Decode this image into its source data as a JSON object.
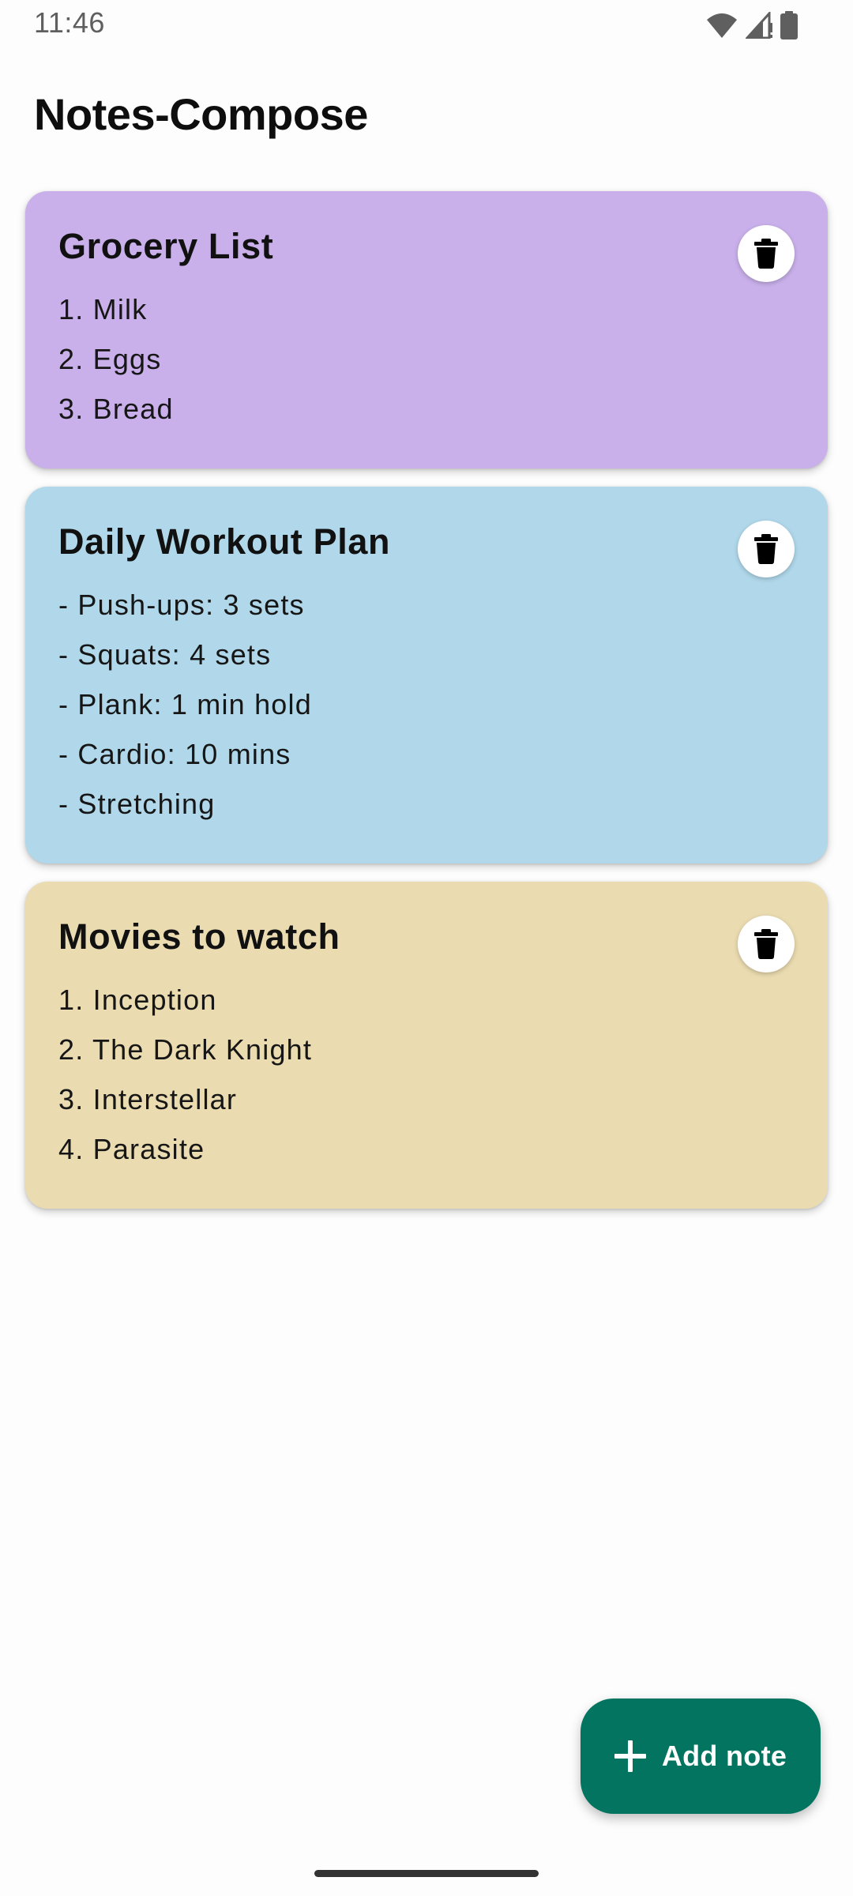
{
  "status_bar": {
    "time": "11:46",
    "icons": [
      "wifi-icon",
      "signal-icon",
      "battery-icon"
    ]
  },
  "app": {
    "title": "Notes-Compose"
  },
  "notes": [
    {
      "title": "Grocery List",
      "color": "#c9b0ea",
      "lines": [
        "1. Milk",
        "2. Eggs",
        "3. Bread"
      ]
    },
    {
      "title": "Daily Workout Plan",
      "color": "#b0d8ea",
      "lines": [
        "- Push-ups: 3 sets",
        "- Squats: 4 sets",
        "- Plank: 1 min hold",
        "- Cardio: 10 mins",
        "- Stretching"
      ]
    },
    {
      "title": "Movies to watch",
      "color": "#eadbb0",
      "lines": [
        "1. Inception",
        "2. The Dark Knight",
        "3. Interstellar",
        "4. Parasite"
      ]
    }
  ],
  "fab": {
    "label": "Add note",
    "color": "#03745f",
    "icon": "plus-icon"
  }
}
